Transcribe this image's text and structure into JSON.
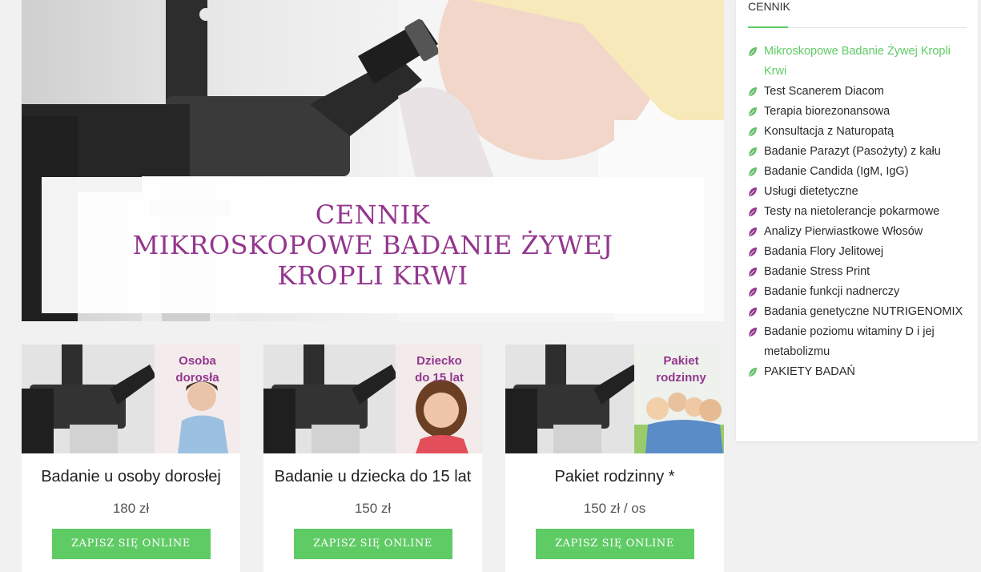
{
  "hero": {
    "title_lines": [
      "CENNIK",
      "MIKROSKOPOWE BADANIE ŻYWEJ",
      "KROPLI KRWI"
    ]
  },
  "cards": [
    {
      "badge_lines": [
        "Osoba",
        "dorosła"
      ],
      "title": "Badanie u osoby dorosłej",
      "price": "180 zł",
      "button": "ZAPISZ SIĘ ONLINE"
    },
    {
      "badge_lines": [
        "Dziecko",
        "do 15 lat"
      ],
      "title": "Badanie u dziecka do 15 lat",
      "price": "150 zł",
      "button": "ZAPISZ SIĘ ONLINE"
    },
    {
      "badge_lines": [
        "Pakiet",
        "rodzinny"
      ],
      "title": "Pakiet rodzinny *",
      "price": "150 zł / os",
      "button": "ZAPISZ SIĘ ONLINE"
    }
  ],
  "sidebar": {
    "heading": "CENNIK",
    "items": [
      {
        "label": "Mikroskopowe Badanie Żywej Kropli Krwi",
        "leaf": "green",
        "active": true
      },
      {
        "label": "Test Scanerem Diacom",
        "leaf": "green"
      },
      {
        "label": "Terapia biorezonansowa",
        "leaf": "green"
      },
      {
        "label": "Konsultacja z Naturopatą",
        "leaf": "green"
      },
      {
        "label": "Badanie Parazyt (Pasożyty) z kału",
        "leaf": "green"
      },
      {
        "label": "Badanie Candida (IgM, IgG)",
        "leaf": "green"
      },
      {
        "label": "Usługi dietetyczne",
        "leaf": "purple"
      },
      {
        "label": "Testy na nietolerancje pokarmowe",
        "leaf": "purple"
      },
      {
        "label": "Analizy Pierwiastkowe Włosów",
        "leaf": "purple"
      },
      {
        "label": "Badania Flory Jelitowej",
        "leaf": "purple"
      },
      {
        "label": "Badanie Stress Print",
        "leaf": "purple"
      },
      {
        "label": "Badanie funkcji nadnerczy",
        "leaf": "purple"
      },
      {
        "label": "Badania genetyczne NUTRIGENOMIX",
        "leaf": "purple"
      },
      {
        "label": "Badanie poziomu witaminy D i jej metabolizmu",
        "leaf": "purple"
      },
      {
        "label": "PAKIETY BADAŃ",
        "leaf": "green"
      }
    ]
  },
  "colors": {
    "accent_green": "#5fcb65",
    "accent_purple": "#93378e",
    "leaf_green": "#66bf6a",
    "leaf_purple": "#93378e"
  },
  "icons": {
    "leaf": "leaf-icon"
  }
}
